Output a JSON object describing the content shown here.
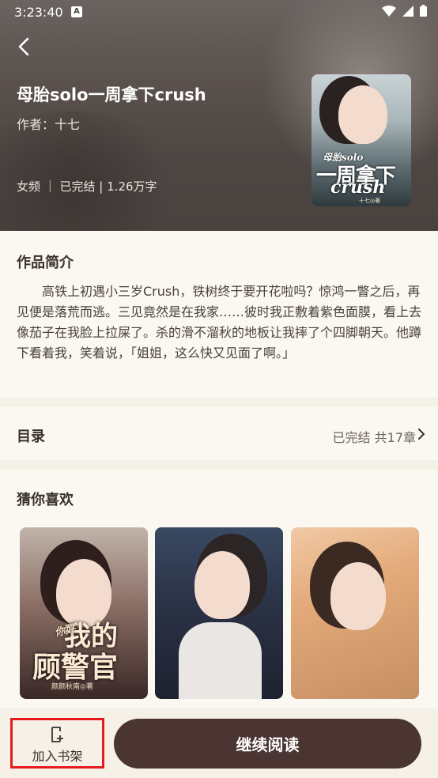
{
  "status_bar": {
    "time": "3:23:40",
    "notification_icon": "A"
  },
  "book": {
    "title": "母胎solo一周拿下crush",
    "author": "作者：十七",
    "meta": "女频 ｜ 已完结 | 1.26万字",
    "cover_text": {
      "small": "母胎solo",
      "big": "一周拿下",
      "eng": "crush",
      "signature": "十七◎著"
    }
  },
  "intro": {
    "title": "作品简介",
    "text": "高铁上初遇小三岁Crush，铁树终于要开花啦吗？惊鸿一瞥之后，再见便是落荒而逃。三见竟然是在我家……彼时我正敷着紫色面膜，看上去像茄子在我脸上拉屎了。杀的滑不溜秋的地板让我摔了个四脚朝天。他蹲下看着我，笑着说，「姐姐，这么快又见面了啊。」"
  },
  "toc": {
    "title": "目录",
    "status": "已完结 共17章"
  },
  "recommend": {
    "title": "猜你喜欢",
    "books": [
      {
        "cover_small": "你好",
        "cover_line1": "我的",
        "cover_line2": "顾警官",
        "cover_author": "颜颜秋南◎著"
      },
      {},
      {}
    ]
  },
  "bottom": {
    "shelf_label": "加入书架",
    "read_label": "继续阅读"
  }
}
